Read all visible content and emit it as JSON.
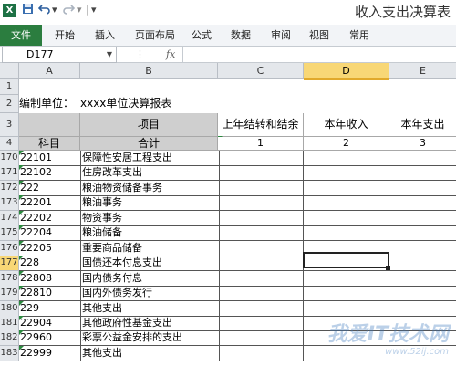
{
  "window": {
    "title": "收入支出决算表"
  },
  "quick_access": {
    "app_icon": "X",
    "save_icon": "save-icon",
    "undo_icon": "undo-icon",
    "redo_icon": "redo-icon",
    "customize_icon": "customize-icon"
  },
  "ribbon": {
    "tabs": [
      "文件",
      "开始",
      "插入",
      "页面布局",
      "公式",
      "数据",
      "审阅",
      "视图",
      "常用"
    ]
  },
  "formula_bar": {
    "name_box": "D177",
    "fx": "fx",
    "value": ""
  },
  "columns": [
    "A",
    "B",
    "C",
    "D",
    "E"
  ],
  "rows": {
    "r1": {
      "num": "1"
    },
    "r2": {
      "num": "2",
      "a": "编制单位：",
      "b": "xxxx单位决算报表"
    },
    "r3": {
      "num": "3",
      "b": "项目",
      "c": "上年结转和结余",
      "d": "本年收入",
      "e": "本年支出"
    },
    "r4": {
      "num": "4",
      "a": "科目",
      "b": "合计",
      "c": "1",
      "d": "2",
      "e": "3"
    }
  },
  "data_rows": [
    {
      "num": "170",
      "code": "22101",
      "name": "保障性安居工程支出"
    },
    {
      "num": "171",
      "code": "22102",
      "name": "住房改革支出"
    },
    {
      "num": "172",
      "code": "222",
      "name": "粮油物资储备事务"
    },
    {
      "num": "173",
      "code": "22201",
      "name": "粮油事务"
    },
    {
      "num": "174",
      "code": "22202",
      "name": "物资事务"
    },
    {
      "num": "175",
      "code": "22204",
      "name": "粮油储备"
    },
    {
      "num": "176",
      "code": "22205",
      "name": "重要商品储备"
    },
    {
      "num": "177",
      "code": "228",
      "name": "国债还本付息支出"
    },
    {
      "num": "178",
      "code": "22808",
      "name": "国内债务付息"
    },
    {
      "num": "179",
      "code": "22810",
      "name": "国内外债务发行"
    },
    {
      "num": "180",
      "code": "229",
      "name": "其他支出"
    },
    {
      "num": "181",
      "code": "22904",
      "name": "其他政府性基金支出"
    },
    {
      "num": "182",
      "code": "22960",
      "name": "彩票公益金安排的支出"
    },
    {
      "num": "183",
      "code": "22999",
      "name": "其他支出"
    }
  ],
  "watermark": {
    "line1": "我爱IT技术网",
    "line2": "www.52ij.com"
  },
  "colors": {
    "file_tab": "#2b7d3f",
    "active_header": "#f8d776",
    "header_fill": "#cfcfcf"
  }
}
